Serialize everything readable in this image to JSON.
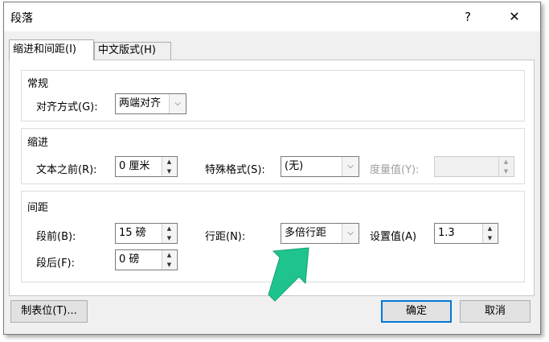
{
  "dialog": {
    "title": "段落",
    "help_label": "?",
    "close_label": "✕"
  },
  "tabs": [
    {
      "label": "缩进和间距(I)",
      "selected": true
    },
    {
      "label": "中文版式(H)",
      "selected": false
    }
  ],
  "general": {
    "title": "常规",
    "alignment_label": "对齐方式(G):",
    "alignment_value": "两端对齐"
  },
  "indent": {
    "title": "缩进",
    "before_text_label": "文本之前(R):",
    "before_text_value": "0 厘米",
    "special_label": "特殊格式(S):",
    "special_value": "(无)",
    "by_label": "度量值(Y):",
    "by_value": ""
  },
  "spacing": {
    "title": "间距",
    "before_label": "段前(B):",
    "before_value": "15 磅",
    "after_label": "段后(F):",
    "after_value": "0 磅",
    "line_spacing_label": "行距(N):",
    "line_spacing_value": "多倍行距",
    "at_label": "设置值(A)",
    "at_value": "1.3"
  },
  "footer": {
    "tabs_button": "制表位(T)...",
    "ok_button": "确定",
    "cancel_button": "取消"
  },
  "icons": {
    "up": "▲",
    "down": "▼",
    "dropdown": "⌵"
  },
  "colors": {
    "arrow": "#1fc38d",
    "default_button_border": "#0078d7"
  }
}
